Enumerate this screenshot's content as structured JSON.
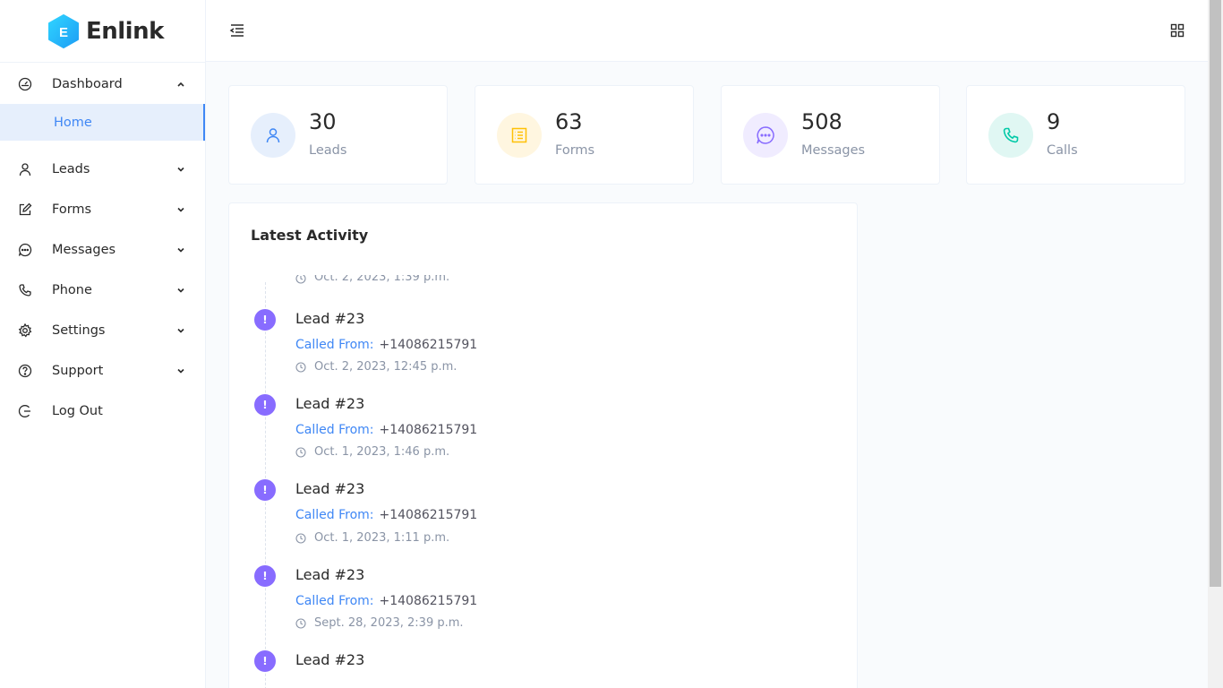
{
  "app": {
    "name": "Enlink",
    "logo_letter": "E"
  },
  "sidebar": {
    "items": [
      {
        "label": "Dashboard",
        "icon": "dashboard-gauge-icon",
        "expanded": true,
        "children": [
          {
            "label": "Home",
            "active": true
          }
        ]
      },
      {
        "label": "Leads",
        "icon": "user-icon"
      },
      {
        "label": "Forms",
        "icon": "form-edit-icon"
      },
      {
        "label": "Messages",
        "icon": "message-icon"
      },
      {
        "label": "Phone",
        "icon": "phone-icon"
      },
      {
        "label": "Settings",
        "icon": "gear-icon"
      },
      {
        "label": "Support",
        "icon": "question-icon"
      },
      {
        "label": "Log Out",
        "icon": "logout-icon"
      }
    ]
  },
  "stats": [
    {
      "value": "30",
      "label": "Leads",
      "icon": "user-icon",
      "color": "#3f87f5",
      "bg": "#e6effc"
    },
    {
      "value": "63",
      "label": "Forms",
      "icon": "list-form-icon",
      "color": "#ffc107",
      "bg": "#fff6e0"
    },
    {
      "value": "508",
      "label": "Messages",
      "icon": "message-icon",
      "color": "#886cff",
      "bg": "#f0ecff"
    },
    {
      "value": "9",
      "label": "Calls",
      "icon": "phone-icon",
      "color": "#00c9a7",
      "bg": "#e0f7f3"
    }
  ],
  "activity": {
    "title": "Latest Activity",
    "top_partial_time": "Oct. 2, 2023, 1:39 p.m.",
    "items": [
      {
        "title": "Lead #23",
        "called_label": "Called From:",
        "phone": "+14086215791",
        "time": "Oct. 2, 2023, 12:45 p.m."
      },
      {
        "title": "Lead #23",
        "called_label": "Called From:",
        "phone": "+14086215791",
        "time": "Oct. 1, 2023, 1:46 p.m."
      },
      {
        "title": "Lead #23",
        "called_label": "Called From:",
        "phone": "+14086215791",
        "time": "Oct. 1, 2023, 1:11 p.m."
      },
      {
        "title": "Lead #23",
        "called_label": "Called From:",
        "phone": "+14086215791",
        "time": "Sept. 28, 2023, 2:39 p.m."
      },
      {
        "title": "Lead #23"
      }
    ],
    "badge_symbol": "!"
  },
  "colors": {
    "primary": "#3f87f5",
    "badge": "#886cff"
  }
}
